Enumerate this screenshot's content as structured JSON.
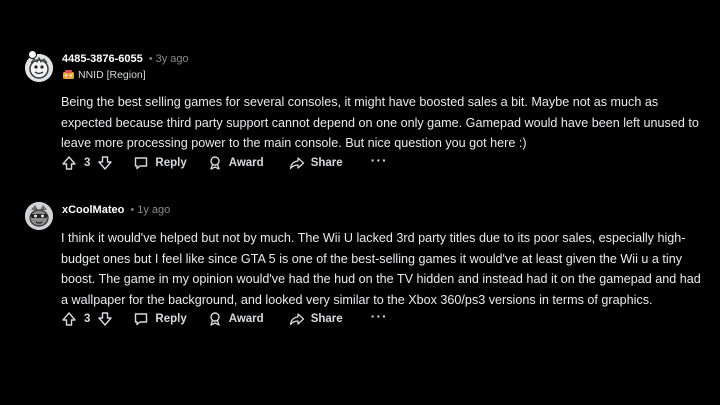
{
  "comments": [
    {
      "author": "4485-3876-6055",
      "time": "3y ago",
      "flair": "NNID [Region]",
      "body": "Being the best selling games for several consoles, it might have boosted sales a bit. Maybe not as much as expected because third party support cannot depend on one only game. Gamepad would have been left unused to leave more processing power to the main console. But nice question you got here :)",
      "votes": "3",
      "reply_label": "Reply",
      "award_label": "Award",
      "share_label": "Share",
      "more_label": "···"
    },
    {
      "author": "xCoolMateo",
      "time": "1y ago",
      "body": "I think it would've helped but not by much. The Wii U lacked 3rd party titles due to its poor sales, especially high-budget ones but I feel like since GTA 5 is one of the best-selling games it would've at least given the Wii u a tiny boost. The game in my opinion would've had the hud on the TV hidden and instead had it on the gamepad and had a wallpaper for the background, and looked very similar to the Xbox 360/ps3 versions in terms of graphics.",
      "votes": "3",
      "reply_label": "Reply",
      "award_label": "Award",
      "share_label": "Share",
      "more_label": "···"
    }
  ],
  "colors": {
    "background": "#000000",
    "text": "#d7dadc",
    "muted": "#8a8a8a"
  }
}
